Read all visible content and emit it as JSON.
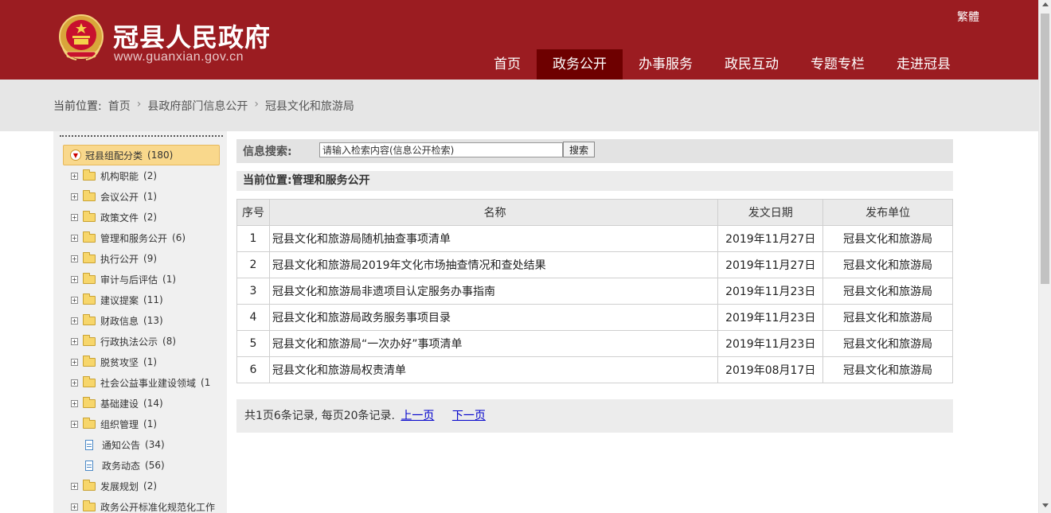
{
  "header": {
    "site_title": "冠县人民政府",
    "site_url": "www.guanxian.gov.cn",
    "traditional_link": "繁體",
    "nav": [
      {
        "label": "首页",
        "active": false
      },
      {
        "label": "政务公开",
        "active": true
      },
      {
        "label": "办事服务",
        "active": false
      },
      {
        "label": "政民互动",
        "active": false
      },
      {
        "label": "专题专栏",
        "active": false
      },
      {
        "label": "走进冠县",
        "active": false
      }
    ],
    "colors": {
      "brand": "#9b1c21",
      "active_nav": "#6e0000"
    }
  },
  "breadcrumb": {
    "label": "当前位置:",
    "items": [
      "首页",
      "县政府部门信息公开",
      "冠县文化和旅游局"
    ]
  },
  "sidebar": {
    "root": {
      "label": "冠县组配分类",
      "count": "(180)"
    },
    "items": [
      {
        "label": "机构职能",
        "count": "(2)",
        "icon": "folder",
        "expandable": true
      },
      {
        "label": "会议公开",
        "count": "(1)",
        "icon": "folder",
        "expandable": true
      },
      {
        "label": "政策文件",
        "count": "(2)",
        "icon": "folder",
        "expandable": true
      },
      {
        "label": "管理和服务公开",
        "count": "(6)",
        "icon": "folder",
        "expandable": true
      },
      {
        "label": "执行公开",
        "count": "(9)",
        "icon": "folder",
        "expandable": true
      },
      {
        "label": "审计与后评估",
        "count": "(1)",
        "icon": "folder",
        "expandable": true
      },
      {
        "label": "建议提案",
        "count": "(11)",
        "icon": "folder",
        "expandable": true
      },
      {
        "label": "财政信息",
        "count": "(13)",
        "icon": "folder",
        "expandable": true
      },
      {
        "label": "行政执法公示",
        "count": "(8)",
        "icon": "folder",
        "expandable": true
      },
      {
        "label": "脱贫攻坚",
        "count": "(1)",
        "icon": "folder",
        "expandable": true
      },
      {
        "label": "社会公益事业建设领域",
        "count": "(1",
        "icon": "folder",
        "expandable": true
      },
      {
        "label": "基础建设",
        "count": "(14)",
        "icon": "folder",
        "expandable": true
      },
      {
        "label": "组织管理",
        "count": "(1)",
        "icon": "folder",
        "expandable": true
      },
      {
        "label": "通知公告",
        "count": "(34)",
        "icon": "document",
        "expandable": false
      },
      {
        "label": "政务动态",
        "count": "(56)",
        "icon": "document",
        "expandable": false
      },
      {
        "label": "发展规划",
        "count": "(2)",
        "icon": "folder",
        "expandable": true
      },
      {
        "label": "政务公开标准化规范化工作",
        "count": "",
        "icon": "folder",
        "expandable": true
      }
    ]
  },
  "search": {
    "label": "信息搜索:",
    "placeholder": "请输入检索内容(信息公开检索)",
    "button": "搜索"
  },
  "position_bar": "当前位置:管理和服务公开",
  "table": {
    "headers": [
      "序号",
      "名称",
      "发文日期",
      "发布单位"
    ],
    "rows": [
      {
        "no": "1",
        "name": "冠县文化和旅游局随机抽查事项清单",
        "date": "2019年11月27日",
        "unit": "冠县文化和旅游局"
      },
      {
        "no": "2",
        "name": "冠县文化和旅游局2019年文化市场抽查情况和查处结果",
        "date": "2019年11月27日",
        "unit": "冠县文化和旅游局"
      },
      {
        "no": "3",
        "name": "冠县文化和旅游局非遗项目认定服务办事指南",
        "date": "2019年11月23日",
        "unit": "冠县文化和旅游局"
      },
      {
        "no": "4",
        "name": "冠县文化和旅游局政务服务事项目录",
        "date": "2019年11月23日",
        "unit": "冠县文化和旅游局"
      },
      {
        "no": "5",
        "name": "冠县文化和旅游局“一次办好”事项清单",
        "date": "2019年11月23日",
        "unit": "冠县文化和旅游局"
      },
      {
        "no": "6",
        "name": "冠县文化和旅游局权责清单",
        "date": "2019年08月17日",
        "unit": "冠县文化和旅游局"
      }
    ]
  },
  "pager": {
    "summary": "共1页6条记录, 每页20条记录.",
    "prev": "上一页",
    "next": "下一页"
  }
}
